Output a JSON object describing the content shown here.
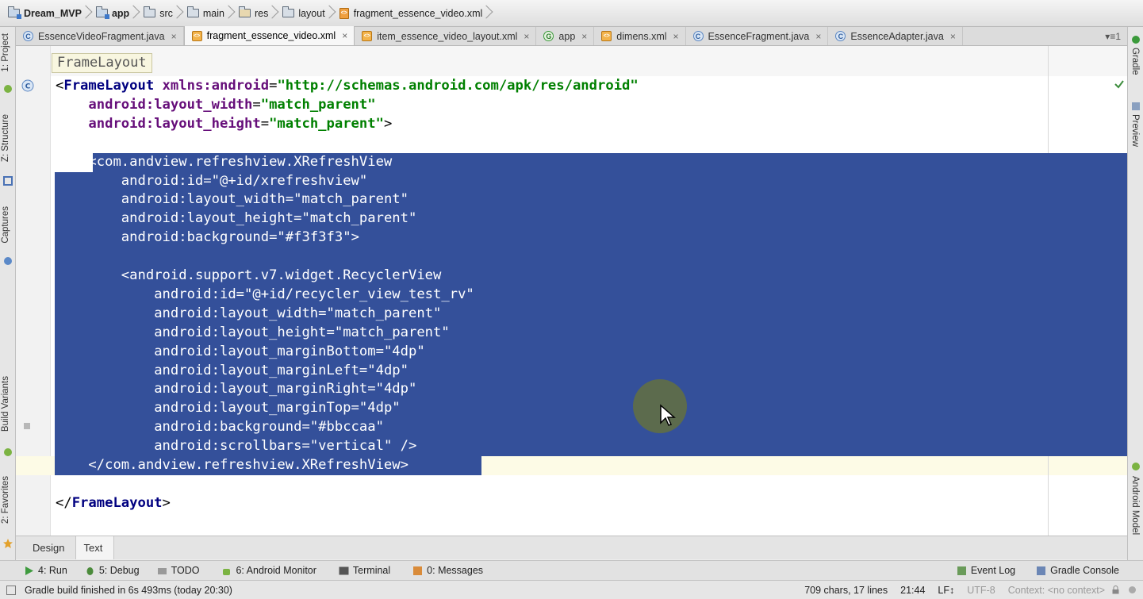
{
  "breadcrumb": [
    {
      "label": "Dream_MVP",
      "bold": true
    },
    {
      "label": "app",
      "bold": true
    },
    {
      "label": "src",
      "bold": false
    },
    {
      "label": "main",
      "bold": false
    },
    {
      "label": "res",
      "bold": false
    },
    {
      "label": "layout",
      "bold": false
    },
    {
      "label": "fragment_essence_video.xml",
      "bold": false
    }
  ],
  "tabs": [
    {
      "label": "EssenceVideoFragment.java",
      "type": "java"
    },
    {
      "label": "fragment_essence_video.xml",
      "type": "xml",
      "active": true
    },
    {
      "label": "item_essence_video_layout.xml",
      "type": "xml"
    },
    {
      "label": "app",
      "type": "gradle"
    },
    {
      "label": "dimens.xml",
      "type": "xml"
    },
    {
      "label": "EssenceFragment.java",
      "type": "java"
    },
    {
      "label": "EssenceAdapter.java",
      "type": "java"
    }
  ],
  "tab_close_glyph": "×",
  "tab_menu": "▾≡1",
  "left_tools": [
    "1: Project",
    "Z: Structure",
    "Captures",
    "Build Variants",
    "2: Favorites"
  ],
  "right_tools": [
    "Gradle",
    "Preview",
    "Android Model"
  ],
  "editor": {
    "structure_hint": "FrameLayout",
    "lines": [
      "<FrameLayout xmlns:android=\"http://schemas.android.com/apk/res/android\"",
      "    android:layout_width=\"match_parent\"",
      "    android:layout_height=\"match_parent\">",
      "",
      "    <com.andview.refreshview.XRefreshView",
      "        android:id=\"@+id/xrefreshview\"",
      "        android:layout_width=\"match_parent\"",
      "        android:layout_height=\"match_parent\"",
      "        android:background=\"#f3f3f3\">",
      "",
      "        <android.support.v7.widget.RecyclerView",
      "            android:id=\"@+id/recycler_view_test_rv\"",
      "            android:layout_width=\"match_parent\"",
      "            android:layout_height=\"match_parent\"",
      "            android:layout_marginBottom=\"4dp\"",
      "            android:layout_marginLeft=\"4dp\"",
      "            android:layout_marginRight=\"4dp\"",
      "            android:layout_marginTop=\"4dp\"",
      "            android:background=\"#bbccaa\"",
      "            android:scrollbars=\"vertical\" />",
      "    </com.andview.refreshview.XRefreshView>",
      "",
      "</FrameLayout>"
    ]
  },
  "mode_tabs": [
    {
      "label": "Design",
      "active": false
    },
    {
      "label": "Text",
      "active": true
    }
  ],
  "tool_windows": [
    {
      "label": "4: Run",
      "icon": "run-icon"
    },
    {
      "label": "5: Debug",
      "icon": "debug-icon"
    },
    {
      "label": "TODO",
      "icon": "todo-icon"
    },
    {
      "label": "6: Android Monitor",
      "icon": "android-icon"
    },
    {
      "label": "Terminal",
      "icon": "terminal-icon"
    },
    {
      "label": "0: Messages",
      "icon": "messages-icon"
    },
    {
      "label": "Event Log",
      "icon": "event-log-icon"
    },
    {
      "label": "Gradle Console",
      "icon": "gradle-console-icon"
    }
  ],
  "status": {
    "message": "Gradle build finished in 6s 493ms (today 20:30)",
    "chars": "709 chars, 17 lines",
    "position": "21:44",
    "line_sep": "LF↕",
    "encoding": "UTF-8",
    "context": "Context: <no context>"
  },
  "colors": {
    "selection": "#34509a",
    "tag": "#000080",
    "attribute": "#660e7a",
    "value": "#008000"
  }
}
